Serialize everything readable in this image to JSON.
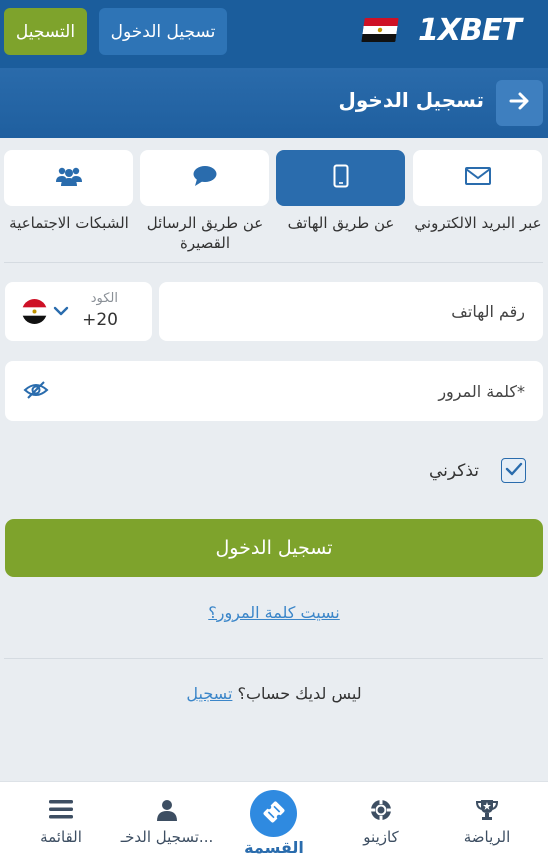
{
  "header": {
    "register_label": "التسجيل",
    "login_label": "تسجيل الدخول",
    "logo_text": "1XBET",
    "flag_icon": "egypt-flag-icon"
  },
  "page": {
    "title": "تسجيل الدخول",
    "back_icon": "arrow-right-icon"
  },
  "tabs": [
    {
      "label": "عبر البريد الالكتروني",
      "icon": "envelope-icon",
      "active": false
    },
    {
      "label": "عن طريق الهاتف",
      "icon": "phone-icon",
      "active": true
    },
    {
      "label": "عن طريق الرسائل القصيرة",
      "icon": "chat-bubble-icon",
      "active": false
    },
    {
      "label": "الشبكات الاجتماعية",
      "icon": "users-icon",
      "active": false
    }
  ],
  "form": {
    "code_label": "الكود",
    "code_value": "+20",
    "phone_placeholder": "رقم الهاتف",
    "password_placeholder": "كلمة المرور*",
    "remember_label": "تذكرني",
    "remember_checked": true,
    "submit_label": "تسجيل الدخول",
    "forgot_label": "نسيت كلمة المرور؟",
    "no_account_text": "ليس لديك حساب؟",
    "signup_link": "تسجيل"
  },
  "bottom_nav": [
    {
      "label": "الرياضة",
      "icon": "trophy-icon"
    },
    {
      "label": "كازينو",
      "icon": "casino-chip-icon"
    },
    {
      "label": "القسمة",
      "icon": "coupon-ticket-icon",
      "active": true
    },
    {
      "label": "تسجيل الدخـ...",
      "icon": "user-icon"
    },
    {
      "label": "القائمة",
      "icon": "menu-icon"
    }
  ],
  "colors": {
    "primary_blue": "#1b5d9c",
    "accent_green": "#7ea32c",
    "link_blue": "#3b86c9"
  }
}
